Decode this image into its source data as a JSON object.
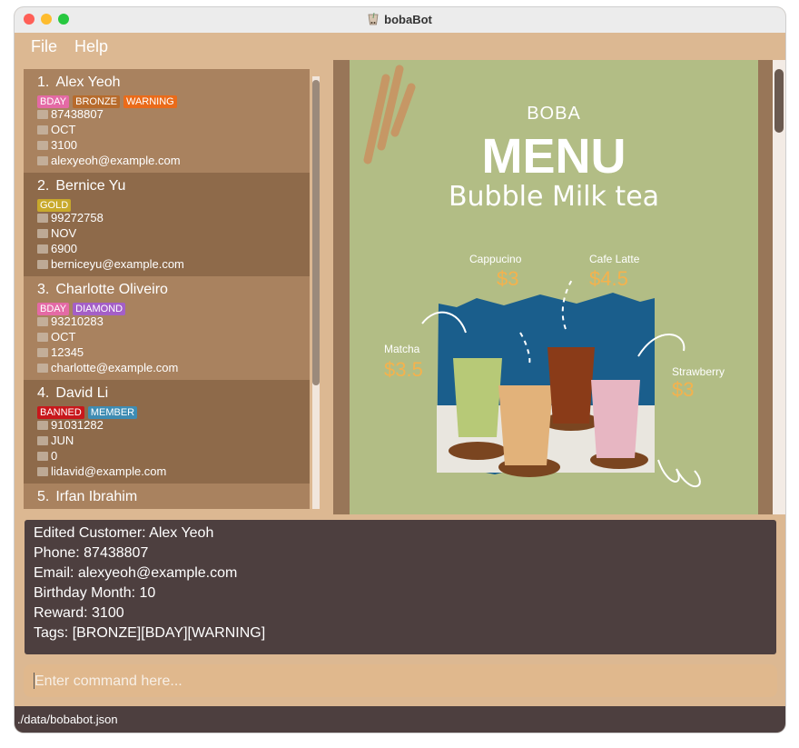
{
  "window": {
    "title": "bobaBot"
  },
  "menu": {
    "file": "File",
    "help": "Help"
  },
  "customers": [
    {
      "index": "1.",
      "name": "Alex Yeoh",
      "tags": [
        {
          "label": "BDAY",
          "color": "#e46aa5"
        },
        {
          "label": "BRONZE",
          "color": "#b76b2c"
        },
        {
          "label": "WARNING",
          "color": "#ea6b1a"
        }
      ],
      "phone": "87438807",
      "birthday": "OCT",
      "reward": "3100",
      "email": "alexyeoh@example.com"
    },
    {
      "index": "2.",
      "name": "Bernice Yu",
      "tags": [
        {
          "label": "GOLD",
          "color": "#c8a92c"
        }
      ],
      "phone": "99272758",
      "birthday": "NOV",
      "reward": "6900",
      "email": "berniceyu@example.com"
    },
    {
      "index": "3.",
      "name": "Charlotte Oliveiro",
      "tags": [
        {
          "label": "BDAY",
          "color": "#e46aa5"
        },
        {
          "label": "DIAMOND",
          "color": "#a45fc7"
        }
      ],
      "phone": "93210283",
      "birthday": "OCT",
      "reward": "12345",
      "email": "charlotte@example.com"
    },
    {
      "index": "4.",
      "name": "David Li",
      "tags": [
        {
          "label": "BANNED",
          "color": "#c8171b"
        },
        {
          "label": "MEMBER",
          "color": "#3e8cb3"
        }
      ],
      "phone": "91031282",
      "birthday": "JUN",
      "reward": "0",
      "email": "lidavid@example.com"
    },
    {
      "index": "5.",
      "name": "Irfan Ibrahim",
      "tags": [
        {
          "label": "",
          "color": "#c9b9a8"
        }
      ],
      "phone": "",
      "birthday": "",
      "reward": "",
      "email": ""
    }
  ],
  "poster": {
    "boba": "BOBA",
    "menu": "MENU",
    "subtitle": "Bubble Milk tea",
    "items": [
      {
        "name": "Cappucino",
        "price": "$3"
      },
      {
        "name": "Cafe Latte",
        "price": "$4.5"
      },
      {
        "name": "Matcha",
        "price": "$3.5"
      },
      {
        "name": "Strawberry",
        "price": "$3"
      }
    ]
  },
  "result": {
    "line1": "Edited Customer: Alex Yeoh",
    "line2": "Phone: 87438807",
    "line3": "Email: alexyeoh@example.com",
    "line4": "Birthday Month: 10",
    "line5": "Reward: 3100",
    "line6": "Tags: [BRONZE][BDAY][WARNING]"
  },
  "command": {
    "placeholder": "Enter command here..."
  },
  "status": {
    "path": "./data/bobabot.json"
  }
}
